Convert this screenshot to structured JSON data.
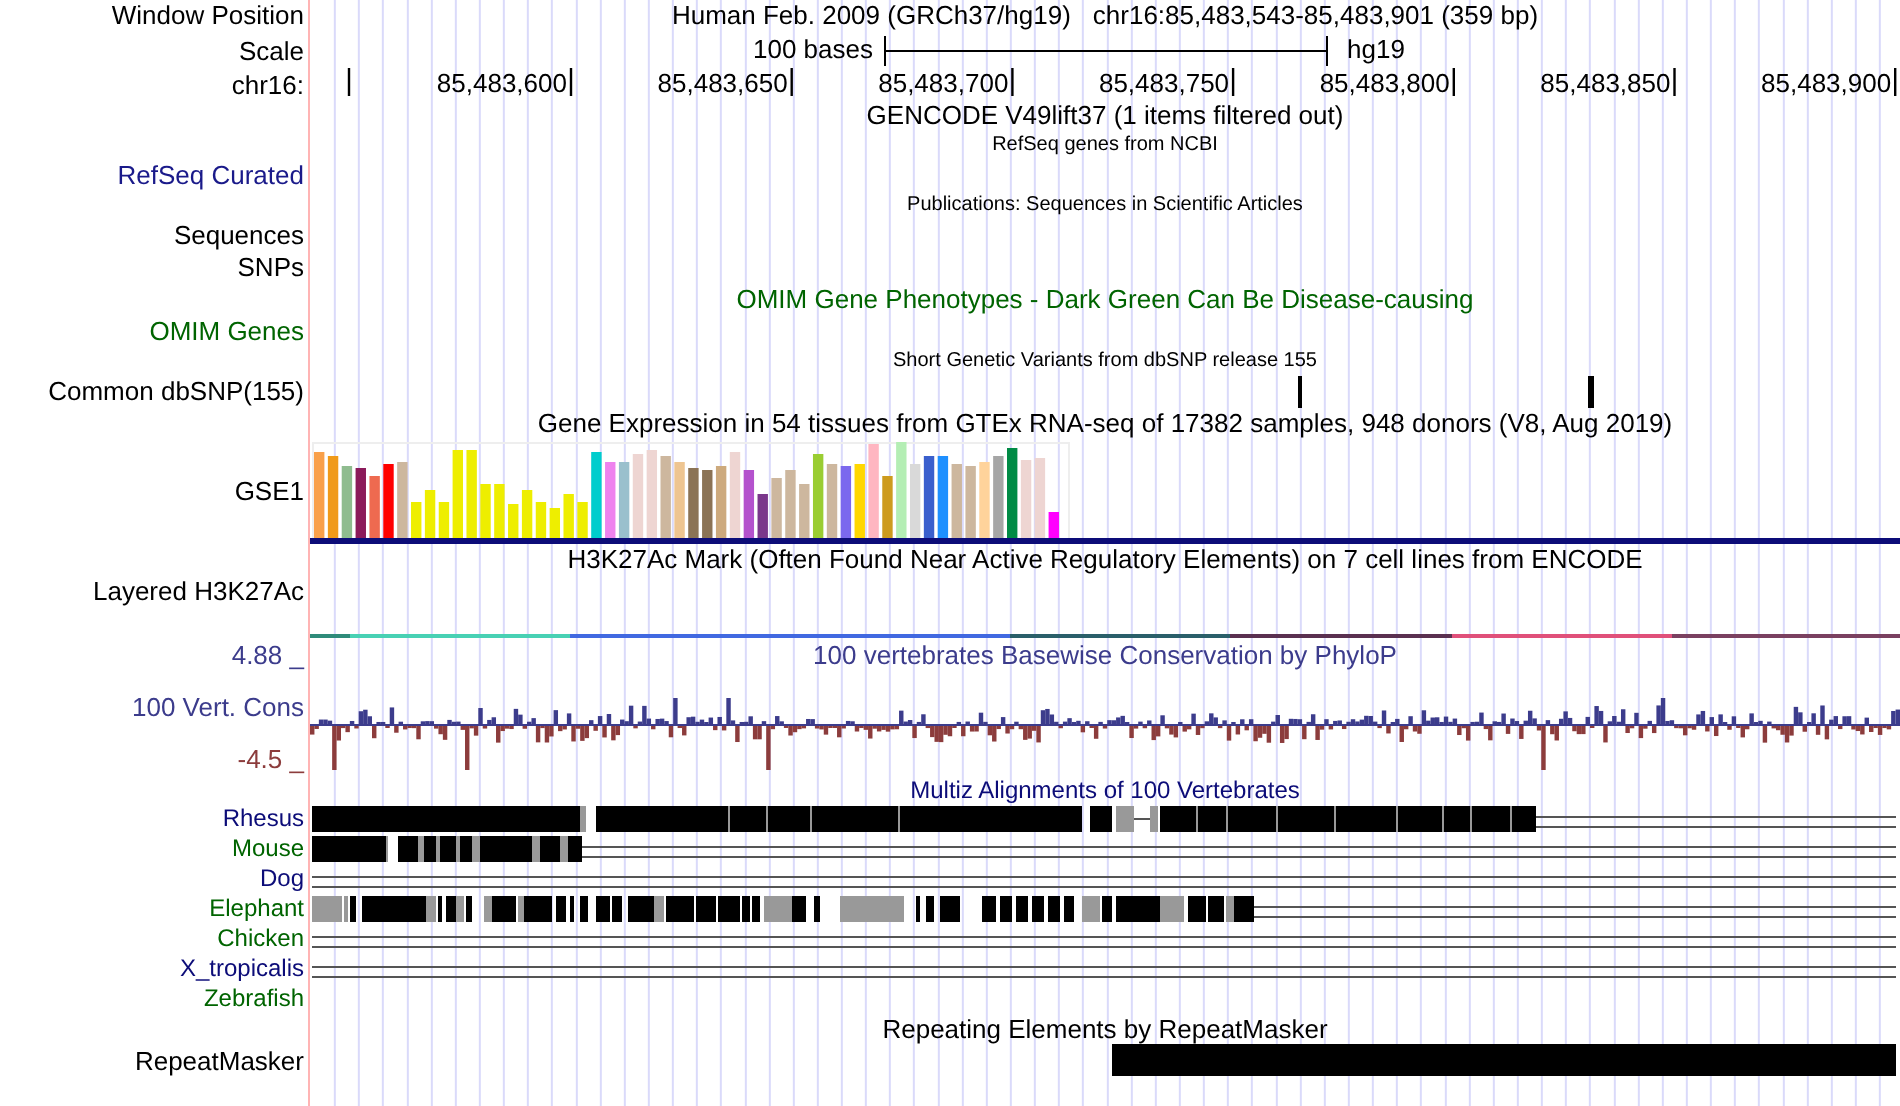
{
  "header": {
    "label": "Window Position",
    "assembly": "Human Feb. 2009 (GRCh37/hg19)",
    "position": "chr16:85,483,543-85,483,901 (359 bp)"
  },
  "scale": {
    "label": "Scale",
    "length": "100 bases",
    "assembly": "hg19"
  },
  "ruler": {
    "label": "chr16:",
    "ticks": [
      "85,483,600",
      "85,483,650",
      "85,483,700",
      "85,483,750",
      "85,483,800",
      "85,483,850",
      "85,483,900"
    ]
  },
  "tracks": [
    {
      "kind": "title-only",
      "title": {
        "text": "GENCODE V49lift37 (1 items filtered out)",
        "color": "#000000",
        "small": false
      }
    },
    {
      "kind": "dense",
      "title": {
        "text": "RefSeq genes from NCBI",
        "color": "#000000",
        "small": true
      },
      "labels": [
        {
          "text": "RefSeq Curated",
          "color": "#1a1a8a"
        }
      ]
    },
    {
      "kind": "dense",
      "title": {
        "text": "Publications: Sequences in Scientific Articles",
        "color": "#000000",
        "small": true
      },
      "labels": [
        {
          "text": "Sequences",
          "color": "#000000"
        },
        {
          "text": "SNPs",
          "color": "#000000"
        }
      ]
    },
    {
      "kind": "dense",
      "title": {
        "text": "OMIM Gene Phenotypes - Dark Green Can Be Disease-causing",
        "color": "#006400",
        "small": false
      },
      "labels": [
        {
          "text": "OMIM Genes",
          "color": "#006400"
        }
      ]
    },
    {
      "kind": "snps",
      "title": {
        "text": "Short Genetic Variants from dbSNP release 155",
        "color": "#000000",
        "small": true
      },
      "labels": [
        {
          "text": "Common dbSNP(155)",
          "color": "#000000"
        }
      ]
    },
    {
      "kind": "bars",
      "title": {
        "text": "Gene Expression in 54 tissues from GTEx RNA-seq of 17382 samples, 948 donors (V8, Aug 2019)",
        "color": "#000000",
        "small": false
      },
      "labels": [
        {
          "text": "GSE1",
          "color": "#000000"
        }
      ]
    },
    {
      "kind": "signal",
      "title": {
        "text": "H3K27Ac Mark (Often Found Near Active Regulatory Elements) on 7 cell lines from ENCODE",
        "color": "#000000",
        "small": false
      },
      "labels": [
        {
          "text": "Layered H3K27Ac",
          "color": "#000000"
        }
      ]
    },
    {
      "kind": "wiggle",
      "title": {
        "text": "100 vertebrates Basewise Conservation by PhyloP",
        "color": "#3c3c8c",
        "small": false
      },
      "max": {
        "text": "4.88 _",
        "color": "#3c3c8c"
      },
      "labels": [
        {
          "text": "100 Vert. Cons",
          "color": "#3c3c8c"
        }
      ],
      "min": {
        "text": "-4.5 _",
        "color": "#8c3c3c"
      }
    },
    {
      "kind": "alignment",
      "title": {
        "text": "Multiz Alignments of 100 Vertebrates",
        "color": "#0c0c78",
        "small": false
      },
      "species": [
        {
          "name": "Rhesus",
          "color": "#0c0c78"
        },
        {
          "name": "Mouse",
          "color": "#006400"
        },
        {
          "name": "Dog",
          "color": "#0c0c78"
        },
        {
          "name": "Elephant",
          "color": "#006400"
        },
        {
          "name": "Chicken",
          "color": "#006400"
        },
        {
          "name": "X_tropicalis",
          "color": "#0c0c78"
        },
        {
          "name": "Zebrafish",
          "color": "#006400"
        }
      ]
    },
    {
      "kind": "repeat",
      "title": {
        "text": "Repeating Elements by RepeatMasker",
        "color": "#000000",
        "small": false
      },
      "labels": [
        {
          "text": "RepeatMasker",
          "color": "#000000"
        }
      ]
    }
  ]
}
